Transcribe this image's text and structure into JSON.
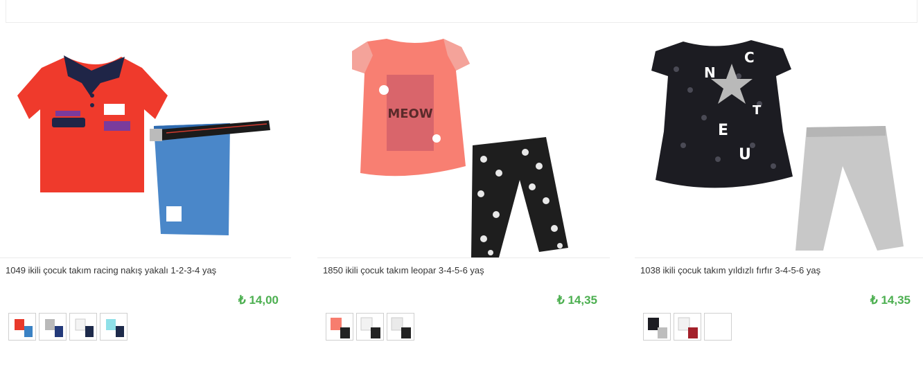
{
  "products": [
    {
      "title": "1049 ikili çocuk takım racing nakış yakalı 1-2-3-4 yaş",
      "price": "₺ 14,00",
      "image_icon": "polo-shirt-shorts-image",
      "thumbnails": [
        {
          "top": "#e8392b",
          "bottom": "#3b82c4"
        },
        {
          "top": "#b9b9b9",
          "bottom": "#233a7a"
        },
        {
          "top": "#f4f4f4",
          "bottom": "#1d2a4a"
        },
        {
          "top": "#8fe0e8",
          "bottom": "#1d2a4a"
        }
      ]
    },
    {
      "title": "1850 ikili çocuk takım leopar 3-4-5-6 yaş",
      "price": "₺ 14,35",
      "image_icon": "tshirt-leopard-leggings-image",
      "thumbnails": [
        {
          "top": "#f77d6e",
          "bottom": "#222222"
        },
        {
          "top": "#f2f2f2",
          "bottom": "#222222"
        },
        {
          "top": "#eaeaea",
          "bottom": "#222222"
        }
      ]
    },
    {
      "title": "1038 ikili çocuk takım yıldızlı fırfır 3-4-5-6 yaş",
      "price": "₺ 14,35",
      "image_icon": "dress-leggings-image",
      "thumbnails": [
        {
          "top": "#1c1c22",
          "bottom": "#bdbdbd"
        },
        {
          "top": "#f2f2f2",
          "bottom": "#a3202a"
        },
        {
          "top": "#ffffff",
          "bottom": "#ffffff"
        }
      ]
    }
  ],
  "colors": {
    "price": "#4caf50",
    "separator": "#eaeaea"
  }
}
